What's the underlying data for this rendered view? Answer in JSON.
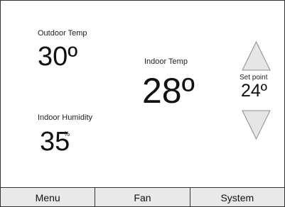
{
  "outdoor": {
    "label": "Outdoor Temp",
    "value": "30º"
  },
  "indoor": {
    "label": "Indoor Temp",
    "value": "28º"
  },
  "humidity": {
    "label": "Indoor Humidity",
    "value": "35",
    "unit": "%"
  },
  "setpoint": {
    "label": "Set point",
    "value": "24º",
    "up_icon": "triangle-up-icon",
    "down_icon": "triangle-down-icon"
  },
  "bottom_bar": {
    "menu_label": "Menu",
    "fan_label": "Fan",
    "system_label": "System"
  },
  "colors": {
    "background": "#ffffff",
    "arrow_fill": "#e6e6e6",
    "arrow_stroke": "#8c8c8c",
    "bar_background": "#e9e9e9"
  }
}
